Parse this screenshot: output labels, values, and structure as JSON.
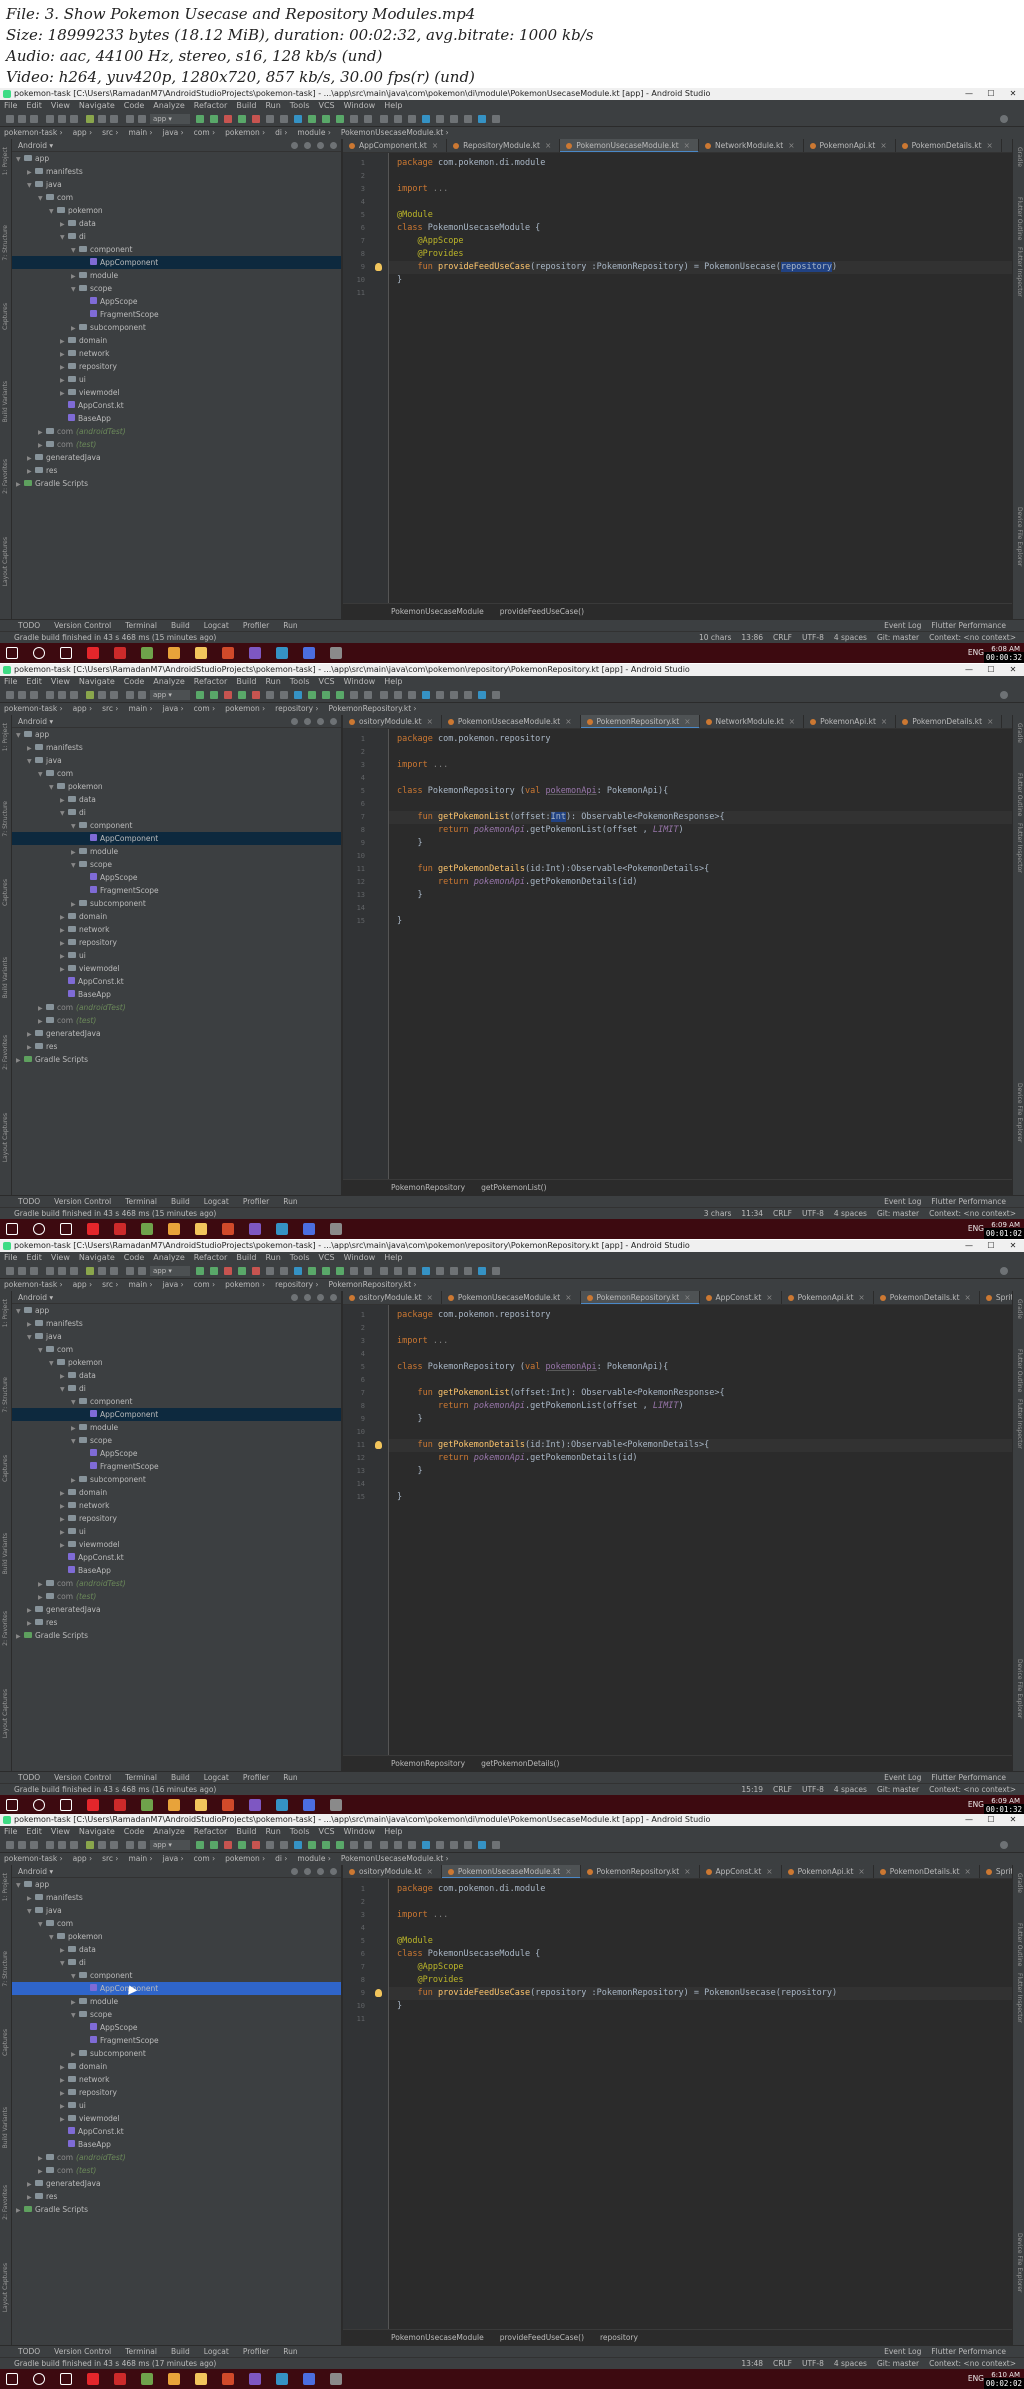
{
  "file_info": {
    "file": "File: 3. Show Pokemon Usecase and Repository Modules.mp4",
    "size": "Size: 18999233 bytes (18.12 MiB), duration: 00:02:32, avg.bitrate: 1000 kb/s",
    "audio": "Audio: aac, 44100 Hz, stereo, s16, 128 kb/s (und)",
    "video": "Video: h264, yuv420p, 1280x720, 857 kb/s, 30.00 fps(r) (und)"
  },
  "common": {
    "menu": [
      "File",
      "Edit",
      "View",
      "Navigate",
      "Code",
      "Analyze",
      "Refactor",
      "Build",
      "Run",
      "Tools",
      "VCS",
      "Window",
      "Help"
    ],
    "run_config": "app",
    "project_label": "Android",
    "bottom_tools": [
      "TODO",
      "Version Control",
      "Terminal",
      "Build",
      "Logcat",
      "Profiler",
      "Run"
    ],
    "bottom_right": [
      "Event Log",
      "Flutter Performance"
    ],
    "left_strip": [
      "1: Project",
      "7: Structure",
      "Captures",
      "Build Variants",
      "2: Favorites",
      "Layout Captures"
    ],
    "right_strip": [
      "Gradle",
      "Flutter Outline",
      "Flutter Inspector",
      "Device File Explorer"
    ],
    "tray": [
      "ENG"
    ],
    "colors": {
      "accent": "#2f65ca",
      "taskbar": "#3d0a10",
      "editor_bg": "#2b2b2b",
      "panel_bg": "#3c3f41"
    }
  },
  "frames": [
    {
      "window_title": "pokemon-task [C:\\Users\\RamadanM7\\AndroidStudioProjects\\pokemon-task] - ...\\app\\src\\main\\java\\com\\pokemon\\di\\module\\PokemonUsecaseModule.kt [app] - Android Studio",
      "nav": [
        "pokemon-task",
        "app",
        "src",
        "main",
        "java",
        "com",
        "pokemon",
        "di",
        "module",
        "PokemonUsecaseModule.kt"
      ],
      "tabs": [
        {
          "label": "AppComponent.kt",
          "active": false
        },
        {
          "label": "RepositoryModule.kt",
          "active": false
        },
        {
          "label": "PokemonUsecaseModule.kt",
          "active": true
        },
        {
          "label": "NetworkModule.kt",
          "active": false
        },
        {
          "label": "PokemonApi.kt",
          "active": false
        },
        {
          "label": "PokemonDetails.kt",
          "active": false
        }
      ],
      "tree": [
        {
          "label": "app",
          "depth": 0,
          "open": true,
          "icon": "folder"
        },
        {
          "label": "manifests",
          "depth": 1,
          "open": false,
          "icon": "folder"
        },
        {
          "label": "java",
          "depth": 1,
          "open": true,
          "icon": "folder"
        },
        {
          "label": "com",
          "depth": 2,
          "open": true,
          "icon": "package"
        },
        {
          "label": "pokemon",
          "depth": 3,
          "open": true,
          "icon": "package"
        },
        {
          "label": "data",
          "depth": 4,
          "open": false,
          "icon": "package"
        },
        {
          "label": "di",
          "depth": 4,
          "open": true,
          "icon": "package"
        },
        {
          "label": "component",
          "depth": 5,
          "open": true,
          "icon": "package"
        },
        {
          "label": "AppComponent",
          "depth": 6,
          "leaf": true,
          "icon": "kotlin",
          "selected": true
        },
        {
          "label": "module",
          "depth": 5,
          "open": false,
          "icon": "package"
        },
        {
          "label": "scope",
          "depth": 5,
          "open": true,
          "icon": "package"
        },
        {
          "label": "AppScope",
          "depth": 6,
          "leaf": true,
          "icon": "kotlin"
        },
        {
          "label": "FragmentScope",
          "depth": 6,
          "leaf": true,
          "icon": "kotlin"
        },
        {
          "label": "subcomponent",
          "depth": 5,
          "open": false,
          "icon": "package"
        },
        {
          "label": "domain",
          "depth": 4,
          "open": false,
          "icon": "package"
        },
        {
          "label": "network",
          "depth": 4,
          "open": false,
          "icon": "package"
        },
        {
          "label": "repository",
          "depth": 4,
          "open": false,
          "icon": "package"
        },
        {
          "label": "ui",
          "depth": 4,
          "open": false,
          "icon": "package"
        },
        {
          "label": "viewmodel",
          "depth": 4,
          "open": false,
          "icon": "package"
        },
        {
          "label": "AppConst.kt",
          "depth": 4,
          "leaf": true,
          "icon": "kotlin"
        },
        {
          "label": "BaseApp",
          "depth": 4,
          "leaf": true,
          "icon": "kotlin"
        },
        {
          "label": "com",
          "suffix": "(androidTest)",
          "depth": 2,
          "open": false,
          "icon": "package"
        },
        {
          "label": "com",
          "suffix": "(test)",
          "depth": 2,
          "open": false,
          "icon": "package"
        },
        {
          "label": "generatedJava",
          "depth": 1,
          "open": false,
          "icon": "folder"
        },
        {
          "label": "res",
          "depth": 1,
          "open": false,
          "icon": "folder"
        },
        {
          "label": "Gradle Scripts",
          "depth": 0,
          "open": false,
          "icon": "gradle"
        }
      ],
      "code": [
        [
          {
            "c": "k",
            "t": "package "
          },
          {
            "t": "com.pokemon.di.module"
          }
        ],
        [],
        [
          {
            "c": "k",
            "t": "import "
          },
          {
            "c": "gr",
            "t": "..."
          }
        ],
        [],
        [
          {
            "c": "an",
            "t": "@Module"
          }
        ],
        [
          {
            "c": "k",
            "t": "class "
          },
          {
            "t": "PokemonUsecaseModule {"
          }
        ],
        [
          {
            "t": "    "
          },
          {
            "c": "an",
            "t": "@AppScope"
          }
        ],
        [
          {
            "t": "    "
          },
          {
            "c": "an",
            "t": "@Provides"
          }
        ],
        [
          {
            "t": "    "
          },
          {
            "c": "k",
            "t": "fun "
          },
          {
            "c": "fn",
            "t": "provideFeedUseCase"
          },
          {
            "t": "(repository :PokemonRepository) = PokemonUsecase("
          },
          {
            "c": "sel",
            "t": "repository"
          },
          {
            "t": ")"
          }
        ],
        [
          {
            "t": "}"
          }
        ],
        []
      ],
      "highlight_line": 8,
      "bulb_line": 8,
      "breadcrumbs": [
        "PokemonUsecaseModule",
        "provideFeedUseCase()"
      ],
      "status_left": "Gradle build finished in 43 s 468 ms (15 minutes ago)",
      "status_right": [
        "10 chars",
        "13:86",
        "CRLF",
        "UTF-8",
        "4 spaces",
        "Git: master",
        "Context: <no context>"
      ],
      "clock": [
        "6:08 AM",
        "7/1/2019"
      ],
      "stamp": "00:00:32"
    },
    {
      "window_title": "pokemon-task [C:\\Users\\RamadanM7\\AndroidStudioProjects\\pokemon-task] - ...\\app\\src\\main\\java\\com\\pokemon\\repository\\PokemonRepository.kt [app] - Android Studio",
      "nav": [
        "pokemon-task",
        "app",
        "src",
        "main",
        "java",
        "com",
        "pokemon",
        "repository",
        "PokemonRepository.kt"
      ],
      "tabs": [
        {
          "label": "ositoryModule.kt",
          "active": false
        },
        {
          "label": "PokemonUsecaseModule.kt",
          "active": false
        },
        {
          "label": "PokemonRepository.kt",
          "active": true
        },
        {
          "label": "NetworkModule.kt",
          "active": false
        },
        {
          "label": "PokemonApi.kt",
          "active": false
        },
        {
          "label": "PokemonDetails.kt",
          "active": false
        }
      ],
      "tree_same_as": 0,
      "code": [
        [
          {
            "c": "k",
            "t": "package "
          },
          {
            "t": "com.pokemon.repository"
          }
        ],
        [],
        [
          {
            "c": "k",
            "t": "import "
          },
          {
            "c": "gr",
            "t": "..."
          }
        ],
        [],
        [
          {
            "c": "k",
            "t": "class "
          },
          {
            "t": "PokemonRepository ("
          },
          {
            "c": "k",
            "t": "val "
          },
          {
            "c": "pr",
            "t": "pokemonApi"
          },
          {
            "t": ": PokemonApi){"
          }
        ],
        [],
        [
          {
            "t": "    "
          },
          {
            "c": "k",
            "t": "fun "
          },
          {
            "c": "fn",
            "t": "getPokemonList"
          },
          {
            "t": "(offset:"
          },
          {
            "c": "sel",
            "t": "Int"
          },
          {
            "t": "): Observable<PokemonResponse>{"
          }
        ],
        [
          {
            "t": "        "
          },
          {
            "c": "k",
            "t": "return "
          },
          {
            "c": "it",
            "t": "pokemonApi"
          },
          {
            "t": ".getPokemonList(offset , "
          },
          {
            "c": "it",
            "t": "LIMIT"
          },
          {
            "t": ")"
          }
        ],
        [
          {
            "t": "    }"
          }
        ],
        [],
        [
          {
            "t": "    "
          },
          {
            "c": "k",
            "t": "fun "
          },
          {
            "c": "fn",
            "t": "getPokemonDetails"
          },
          {
            "t": "(id:Int):Observable<PokemonDetails>{"
          }
        ],
        [
          {
            "t": "        "
          },
          {
            "c": "k",
            "t": "return "
          },
          {
            "c": "it",
            "t": "pokemonApi"
          },
          {
            "t": ".getPokemonDetails(id)"
          }
        ],
        [
          {
            "t": "    }"
          }
        ],
        [],
        [
          {
            "t": "}"
          }
        ]
      ],
      "highlight_line": 6,
      "bulb_line": -1,
      "breadcrumbs": [
        "PokemonRepository",
        "getPokemonList()"
      ],
      "status_left": "Gradle build finished in 43 s 468 ms (15 minutes ago)",
      "status_right": [
        "3 chars",
        "11:34",
        "CRLF",
        "UTF-8",
        "4 spaces",
        "Git: master",
        "Context: <no context>"
      ],
      "clock": [
        "6:09 AM",
        "7/1/2019"
      ],
      "stamp": "00:01:02"
    },
    {
      "window_title": "pokemon-task [C:\\Users\\RamadanM7\\AndroidStudioProjects\\pokemon-task] - ...\\app\\src\\main\\java\\com\\pokemon\\repository\\PokemonRepository.kt [app] - Android Studio",
      "nav": [
        "pokemon-task",
        "app",
        "src",
        "main",
        "java",
        "com",
        "pokemon",
        "repository",
        "PokemonRepository.kt"
      ],
      "tabs": [
        {
          "label": "ositoryModule.kt",
          "active": false
        },
        {
          "label": "PokemonUsecaseModule.kt",
          "active": false
        },
        {
          "label": "PokemonRepository.kt",
          "active": true
        },
        {
          "label": "AppConst.kt",
          "active": false
        },
        {
          "label": "PokemonApi.kt",
          "active": false
        },
        {
          "label": "PokemonDetails.kt",
          "active": false
        },
        {
          "label": "Sprites.kt",
          "active": false
        }
      ],
      "tree_same_as": 0,
      "code": [
        [
          {
            "c": "k",
            "t": "package "
          },
          {
            "t": "com.pokemon.repository"
          }
        ],
        [],
        [
          {
            "c": "k",
            "t": "import "
          },
          {
            "c": "gr",
            "t": "..."
          }
        ],
        [],
        [
          {
            "c": "k",
            "t": "class "
          },
          {
            "t": "PokemonRepository ("
          },
          {
            "c": "k",
            "t": "val "
          },
          {
            "c": "pr",
            "t": "pokemonApi"
          },
          {
            "t": ": PokemonApi){"
          }
        ],
        [],
        [
          {
            "t": "    "
          },
          {
            "c": "k",
            "t": "fun "
          },
          {
            "c": "fn",
            "t": "getPokemonList"
          },
          {
            "t": "(offset:Int): Observable<PokemonResponse>{"
          }
        ],
        [
          {
            "t": "        "
          },
          {
            "c": "k",
            "t": "return "
          },
          {
            "c": "it",
            "t": "pokemonApi"
          },
          {
            "t": ".getPokemonList(offset , "
          },
          {
            "c": "it",
            "t": "LIMIT"
          },
          {
            "t": ")"
          }
        ],
        [
          {
            "t": "    }"
          }
        ],
        [],
        [
          {
            "t": "    "
          },
          {
            "c": "k",
            "t": "fun "
          },
          {
            "c": "fn",
            "t": "getPokemonDetails"
          },
          {
            "t": "(id:Int):Observable<PokemonDetails>{"
          }
        ],
        [
          {
            "t": "        "
          },
          {
            "c": "k",
            "t": "return "
          },
          {
            "c": "it",
            "t": "pokemonApi"
          },
          {
            "t": ".getPokemonDetails(id)"
          }
        ],
        [
          {
            "t": "    }"
          }
        ],
        [],
        [
          {
            "t": "}"
          }
        ]
      ],
      "highlight_line": 10,
      "bulb_line": 10,
      "breadcrumbs": [
        "PokemonRepository",
        "getPokemonDetails()"
      ],
      "status_left": "Gradle build finished in 43 s 468 ms (16 minutes ago)",
      "status_right": [
        "15:19",
        "CRLF",
        "UTF-8",
        "4 spaces",
        "Git: master",
        "Context: <no context>"
      ],
      "clock": [
        "6:09 AM",
        "7/1/2019"
      ],
      "stamp": "00:01:32"
    },
    {
      "window_title": "pokemon-task [C:\\Users\\RamadanM7\\AndroidStudioProjects\\pokemon-task] - ...\\app\\src\\main\\java\\com\\pokemon\\di\\module\\PokemonUsecaseModule.kt [app] - Android Studio",
      "nav": [
        "pokemon-task",
        "app",
        "src",
        "main",
        "java",
        "com",
        "pokemon",
        "di",
        "module",
        "PokemonUsecaseModule.kt"
      ],
      "tabs": [
        {
          "label": "ositoryModule.kt",
          "active": false
        },
        {
          "label": "PokemonUsecaseModule.kt",
          "active": true
        },
        {
          "label": "PokemonRepository.kt",
          "active": false
        },
        {
          "label": "AppConst.kt",
          "active": false
        },
        {
          "label": "PokemonApi.kt",
          "active": false
        },
        {
          "label": "PokemonDetails.kt",
          "active": false
        },
        {
          "label": "Sprites.kt",
          "active": false
        }
      ],
      "tree_same_as": 0,
      "tree_active": true,
      "code": [
        [
          {
            "c": "k",
            "t": "package "
          },
          {
            "t": "com.pokemon.di.module"
          }
        ],
        [],
        [
          {
            "c": "k",
            "t": "import "
          },
          {
            "c": "gr",
            "t": "..."
          }
        ],
        [],
        [
          {
            "c": "an",
            "t": "@Module"
          }
        ],
        [
          {
            "c": "k",
            "t": "class "
          },
          {
            "t": "PokemonUsecaseModule {"
          }
        ],
        [
          {
            "t": "    "
          },
          {
            "c": "an",
            "t": "@AppScope"
          }
        ],
        [
          {
            "t": "    "
          },
          {
            "c": "an",
            "t": "@Provides"
          }
        ],
        [
          {
            "t": "    "
          },
          {
            "c": "k",
            "t": "fun "
          },
          {
            "c": "fn",
            "t": "provideFeedUseCase"
          },
          {
            "t": "(repository :PokemonRepository) = PokemonUsecase(repository)"
          }
        ],
        [
          {
            "t": "}"
          }
        ],
        []
      ],
      "highlight_line": 8,
      "bulb_line": 8,
      "breadcrumbs": [
        "PokemonUsecaseModule",
        "provideFeedUseCase()",
        "repository"
      ],
      "status_left": "Gradle build finished in 43 s 468 ms (17 minutes ago)",
      "status_right": [
        "13:48",
        "CRLF",
        "UTF-8",
        "4 spaces",
        "Git: master",
        "Context: <no context>"
      ],
      "clock": [
        "6:10 AM",
        "7/1/2019"
      ],
      "stamp": "00:02:02"
    }
  ]
}
